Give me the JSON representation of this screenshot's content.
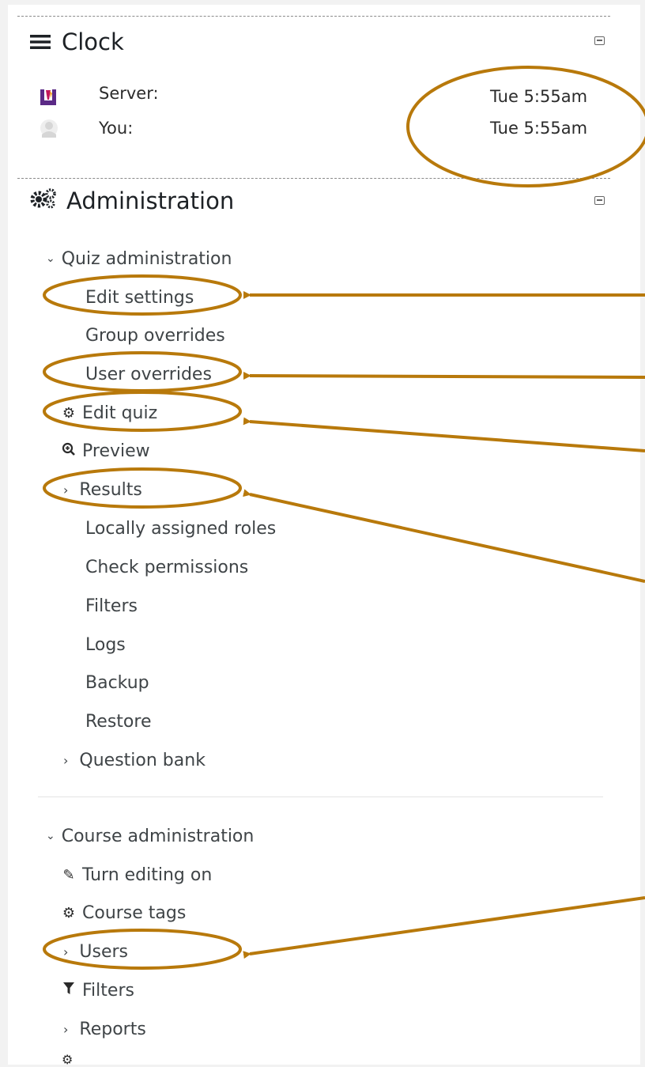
{
  "clock": {
    "title": "Clock",
    "server_label": "Server:",
    "server_time": "Tue 5:55am",
    "you_label": "You:",
    "you_time": "Tue 5:55am"
  },
  "administration": {
    "title": "Administration",
    "quiz_admin": {
      "label": "Quiz administration",
      "items": [
        "Edit settings",
        "Group overrides",
        "User overrides",
        "Edit quiz",
        "Preview",
        "Results",
        "Locally assigned roles",
        "Check permissions",
        "Filters",
        "Logs",
        "Backup",
        "Restore",
        "Question bank"
      ]
    },
    "course_admin": {
      "label": "Course administration",
      "items": [
        "Turn editing on",
        "Course tags",
        "Users",
        "Filters",
        "Reports"
      ]
    }
  },
  "colors": {
    "annotation": "#b8790b",
    "logo_red": "#c2185b",
    "logo_orange": "#f5a623",
    "logo_purple": "#5b2a86"
  }
}
